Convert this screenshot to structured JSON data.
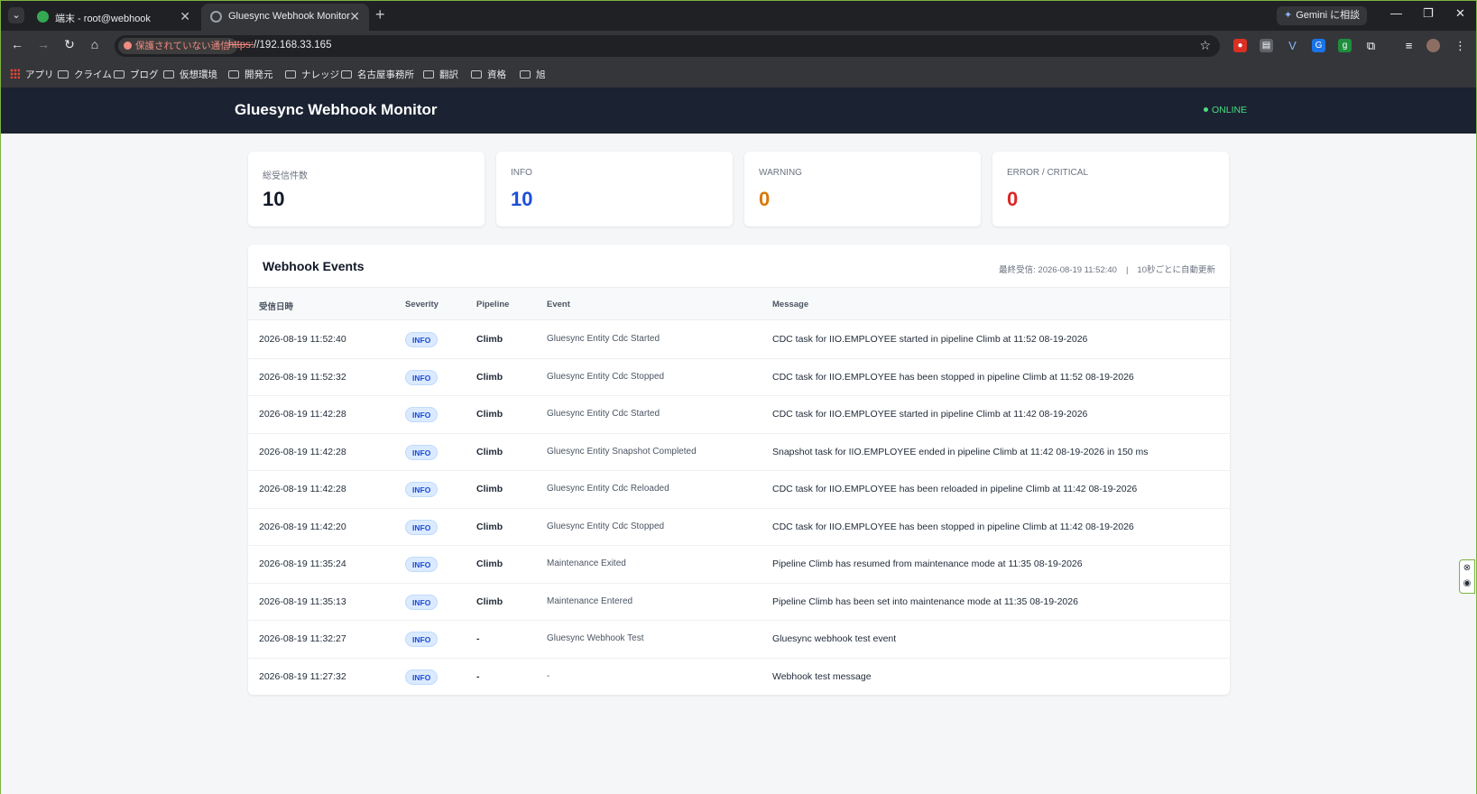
{
  "browser": {
    "tabs": [
      {
        "label": "端末 - root@webhook",
        "close": "✕"
      },
      {
        "label": "Gluesync Webhook Monitor",
        "close": "✕"
      }
    ],
    "new_tab": "+",
    "gemini_label": "Gemini に相談",
    "security_chip": "保護されていない通信",
    "url_scheme": "https:",
    "url_rest": "//192.168.33.165",
    "bookmarks": [
      "アプリ",
      "クライム",
      "ブログ",
      "仮想環境",
      "開発元",
      "ナレッジ",
      "名古屋事務所",
      "翻訳",
      "資格",
      "旭"
    ]
  },
  "header": {
    "title": "Gluesync Webhook Monitor",
    "status": "ONLINE"
  },
  "stats": [
    {
      "label": "総受信件数",
      "value": "10",
      "color": "#111827"
    },
    {
      "label": "INFO",
      "value": "10",
      "color": "#1d4ed8"
    },
    {
      "label": "WARNING",
      "value": "0",
      "color": "#d97706"
    },
    {
      "label": "ERROR / CRITICAL",
      "value": "0",
      "color": "#dc2626"
    }
  ],
  "events": {
    "title": "Webhook Events",
    "last_received": "最終受信: 2026-08-19 11:52:40",
    "separator": "|",
    "refresh_note": "10秒ごとに自動更新",
    "columns": [
      "受信日時",
      "Severity",
      "Pipeline",
      "Event",
      "Message"
    ],
    "rows": [
      {
        "time": "2026-08-19 11:52:40",
        "severity": "INFO",
        "pipeline": "Climb",
        "event": "Gluesync Entity Cdc Started",
        "message": "CDC task for IIO.EMPLOYEE started in pipeline Climb at 11:52 08-19-2026"
      },
      {
        "time": "2026-08-19 11:52:32",
        "severity": "INFO",
        "pipeline": "Climb",
        "event": "Gluesync Entity Cdc Stopped",
        "message": "CDC task for IIO.EMPLOYEE has been stopped in pipeline Climb at 11:52 08-19-2026"
      },
      {
        "time": "2026-08-19 11:42:28",
        "severity": "INFO",
        "pipeline": "Climb",
        "event": "Gluesync Entity Cdc Started",
        "message": "CDC task for IIO.EMPLOYEE started in pipeline Climb at 11:42 08-19-2026"
      },
      {
        "time": "2026-08-19 11:42:28",
        "severity": "INFO",
        "pipeline": "Climb",
        "event": "Gluesync Entity Snapshot Completed",
        "message": "Snapshot task for IIO.EMPLOYEE ended in pipeline Climb at 11:42 08-19-2026 in 150 ms"
      },
      {
        "time": "2026-08-19 11:42:28",
        "severity": "INFO",
        "pipeline": "Climb",
        "event": "Gluesync Entity Cdc Reloaded",
        "message": "CDC task for IIO.EMPLOYEE has been reloaded in pipeline Climb at 11:42 08-19-2026"
      },
      {
        "time": "2026-08-19 11:42:20",
        "severity": "INFO",
        "pipeline": "Climb",
        "event": "Gluesync Entity Cdc Stopped",
        "message": "CDC task for IIO.EMPLOYEE has been stopped in pipeline Climb at 11:42 08-19-2026"
      },
      {
        "time": "2026-08-19 11:35:24",
        "severity": "INFO",
        "pipeline": "Climb",
        "event": "Maintenance Exited",
        "message": "Pipeline Climb has resumed from maintenance mode at 11:35 08-19-2026"
      },
      {
        "time": "2026-08-19 11:35:13",
        "severity": "INFO",
        "pipeline": "Climb",
        "event": "Maintenance Entered",
        "message": "Pipeline Climb has been set into maintenance mode at 11:35 08-19-2026"
      },
      {
        "time": "2026-08-19 11:32:27",
        "severity": "INFO",
        "pipeline": "-",
        "event": "Gluesync Webhook Test",
        "message": "Gluesync webhook test event"
      },
      {
        "time": "2026-08-19 11:27:32",
        "severity": "INFO",
        "pipeline": "-",
        "event": "-",
        "message": "Webhook test message"
      }
    ]
  }
}
